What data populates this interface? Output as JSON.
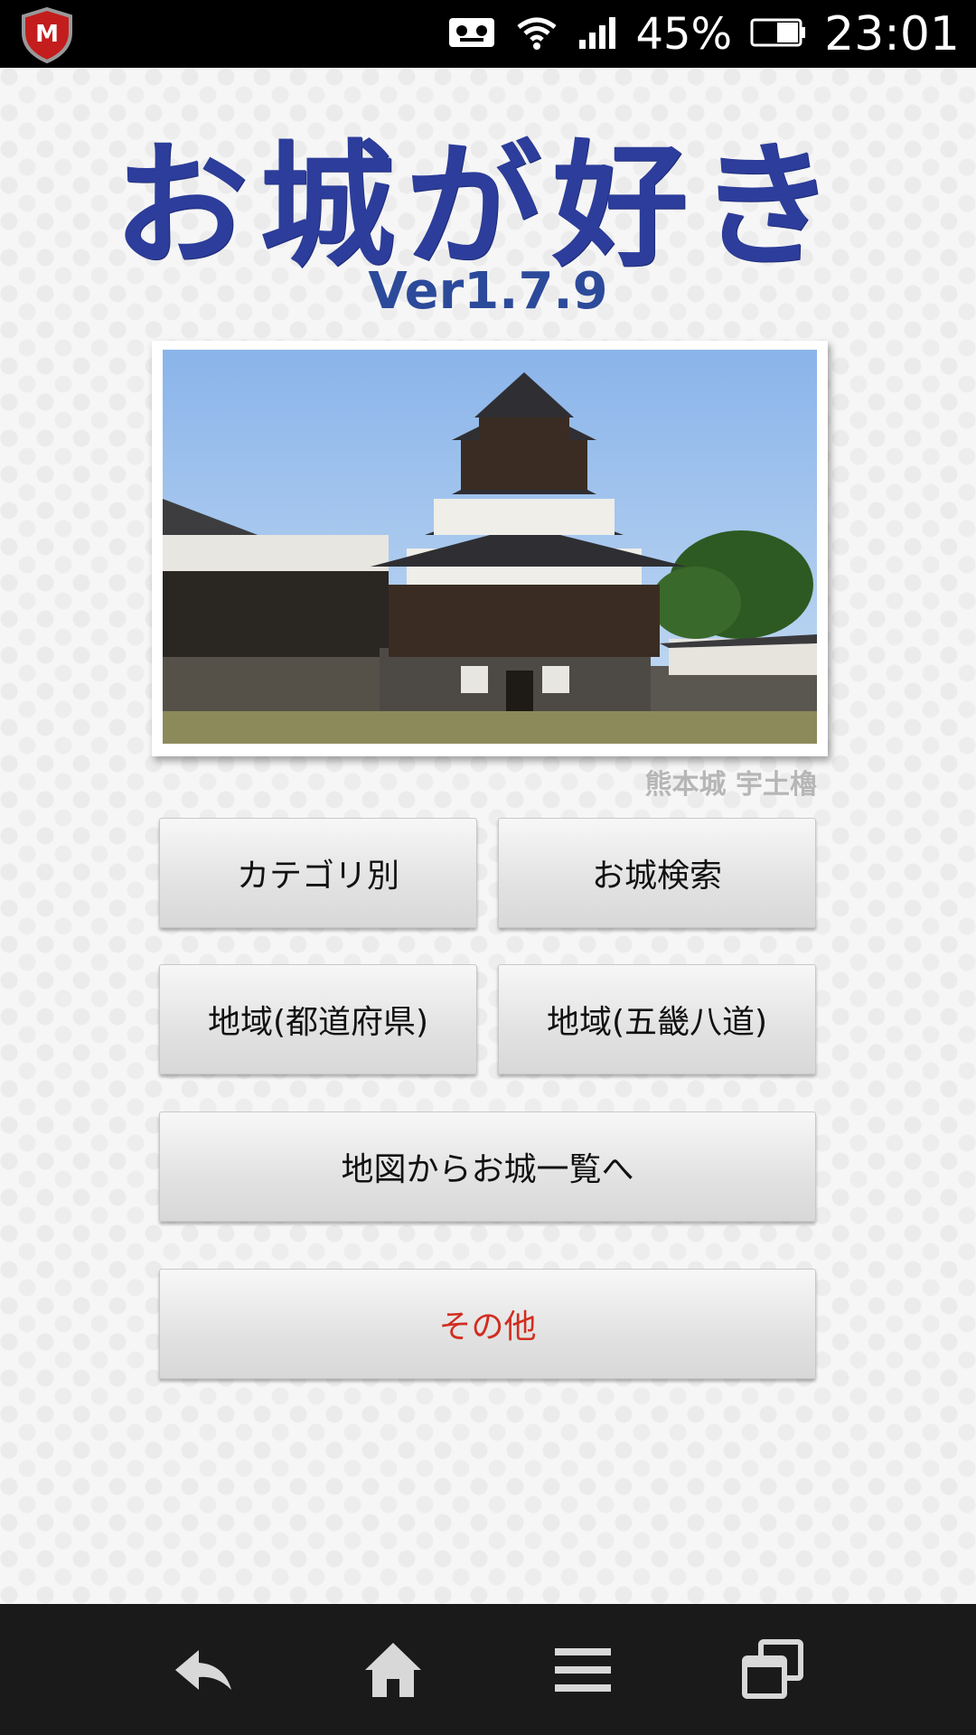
{
  "status_bar": {
    "battery_percent": "45%",
    "time": "23:01",
    "icons": [
      "mcafee-icon",
      "voicemail-icon",
      "wifi-icon",
      "signal-icon",
      "battery-icon"
    ]
  },
  "app": {
    "title": "お城が好き",
    "version": "Ver1.7.9",
    "photo_caption": "熊本城 宇土櫓"
  },
  "buttons": {
    "category": "カテゴリ別",
    "search": "お城検索",
    "region_prefecture": "地域(都道府県)",
    "region_gokishichido": "地域(五畿八道)",
    "map_list": "地図からお城一覧へ",
    "other": "その他"
  },
  "colors": {
    "title": "#2d3d9b",
    "version": "#2c4a9a",
    "other_button_text": "#d12d20"
  },
  "nav_bar": {
    "icons": [
      "back-icon",
      "home-icon",
      "menu-icon",
      "recent-apps-icon"
    ]
  }
}
